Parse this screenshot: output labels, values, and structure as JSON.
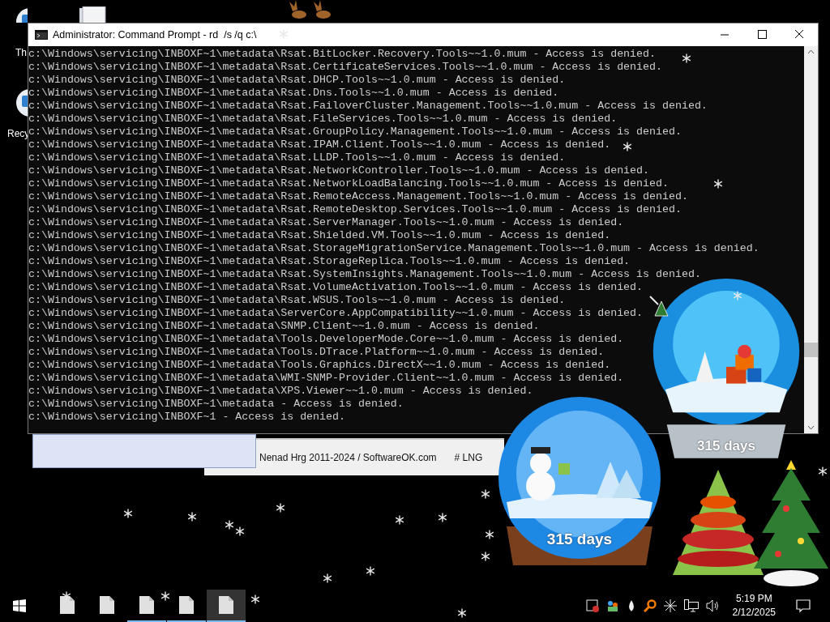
{
  "desktop": {
    "icons": [
      {
        "label": "Th"
      },
      {
        "label": "Recy"
      }
    ]
  },
  "console": {
    "title": "Administrator: Command Prompt - rd  /s /q c:\\",
    "lines": [
      "c:\\Windows\\servicing\\INBOXF~1\\metadata\\Rsat.BitLocker.Recovery.Tools~~1.0.mum - Access is denied.",
      "c:\\Windows\\servicing\\INBOXF~1\\metadata\\Rsat.CertificateServices.Tools~~1.0.mum - Access is denied.",
      "c:\\Windows\\servicing\\INBOXF~1\\metadata\\Rsat.DHCP.Tools~~1.0.mum - Access is denied.",
      "c:\\Windows\\servicing\\INBOXF~1\\metadata\\Rsat.Dns.Tools~~1.0.mum - Access is denied.",
      "c:\\Windows\\servicing\\INBOXF~1\\metadata\\Rsat.FailoverCluster.Management.Tools~~1.0.mum - Access is denied.",
      "c:\\Windows\\servicing\\INBOXF~1\\metadata\\Rsat.FileServices.Tools~~1.0.mum - Access is denied.",
      "c:\\Windows\\servicing\\INBOXF~1\\metadata\\Rsat.GroupPolicy.Management.Tools~~1.0.mum - Access is denied.",
      "c:\\Windows\\servicing\\INBOXF~1\\metadata\\Rsat.IPAM.Client.Tools~~1.0.mum - Access is denied.",
      "c:\\Windows\\servicing\\INBOXF~1\\metadata\\Rsat.LLDP.Tools~~1.0.mum - Access is denied.",
      "c:\\Windows\\servicing\\INBOXF~1\\metadata\\Rsat.NetworkController.Tools~~1.0.mum - Access is denied.",
      "c:\\Windows\\servicing\\INBOXF~1\\metadata\\Rsat.NetworkLoadBalancing.Tools~~1.0.mum - Access is denied.",
      "c:\\Windows\\servicing\\INBOXF~1\\metadata\\Rsat.RemoteAccess.Management.Tools~~1.0.mum - Access is denied.",
      "c:\\Windows\\servicing\\INBOXF~1\\metadata\\Rsat.RemoteDesktop.Services.Tools~~1.0.mum - Access is denied.",
      "c:\\Windows\\servicing\\INBOXF~1\\metadata\\Rsat.ServerManager.Tools~~1.0.mum - Access is denied.",
      "c:\\Windows\\servicing\\INBOXF~1\\metadata\\Rsat.Shielded.VM.Tools~~1.0.mum - Access is denied.",
      "c:\\Windows\\servicing\\INBOXF~1\\metadata\\Rsat.StorageMigrationService.Management.Tools~~1.0.mum - Access is denied.",
      "c:\\Windows\\servicing\\INBOXF~1\\metadata\\Rsat.StorageReplica.Tools~~1.0.mum - Access is denied.",
      "c:\\Windows\\servicing\\INBOXF~1\\metadata\\Rsat.SystemInsights.Management.Tools~~1.0.mum - Access is denied.",
      "c:\\Windows\\servicing\\INBOXF~1\\metadata\\Rsat.VolumeActivation.Tools~~1.0.mum - Access is denied.",
      "c:\\Windows\\servicing\\INBOXF~1\\metadata\\Rsat.WSUS.Tools~~1.0.mum - Access is denied.",
      "c:\\Windows\\servicing\\INBOXF~1\\metadata\\ServerCore.AppCompatibility~~1.0.mum - Access is denied.",
      "c:\\Windows\\servicing\\INBOXF~1\\metadata\\SNMP.Client~~1.0.mum - Access is denied.",
      "c:\\Windows\\servicing\\INBOXF~1\\metadata\\Tools.DeveloperMode.Core~~1.0.mum - Access is denied.",
      "c:\\Windows\\servicing\\INBOXF~1\\metadata\\Tools.DTrace.Platform~~1.0.mum - Access is denied.",
      "c:\\Windows\\servicing\\INBOXF~1\\metadata\\Tools.Graphics.DirectX~~1.0.mum - Access is denied.",
      "c:\\Windows\\servicing\\INBOXF~1\\metadata\\WMI-SNMP-Provider.Client~~1.0.mum - Access is denied.",
      "c:\\Windows\\servicing\\INBOXF~1\\metadata\\XPS.Viewer~~1.0.mum - Access is denied.",
      "c:\\Windows\\servicing\\INBOXF~1\\metadata - Access is denied.",
      "c:\\Windows\\servicing\\INBOXF~1 - Access is denied."
    ]
  },
  "background_window": {
    "status_text": "Nenad Hrg 2011-2024 / SoftwareOK.com",
    "language": "# LNG"
  },
  "snow_globes": [
    {
      "caption": "315 days"
    },
    {
      "caption": "315 days"
    }
  ],
  "taskbar": {
    "apps": [
      {
        "running": false,
        "selected": false
      },
      {
        "running": false,
        "selected": false
      },
      {
        "running": true,
        "selected": false
      },
      {
        "running": true,
        "selected": false
      },
      {
        "running": true,
        "selected": true
      }
    ],
    "clock": {
      "time": "5:19 PM",
      "date": "2/12/2025"
    }
  }
}
